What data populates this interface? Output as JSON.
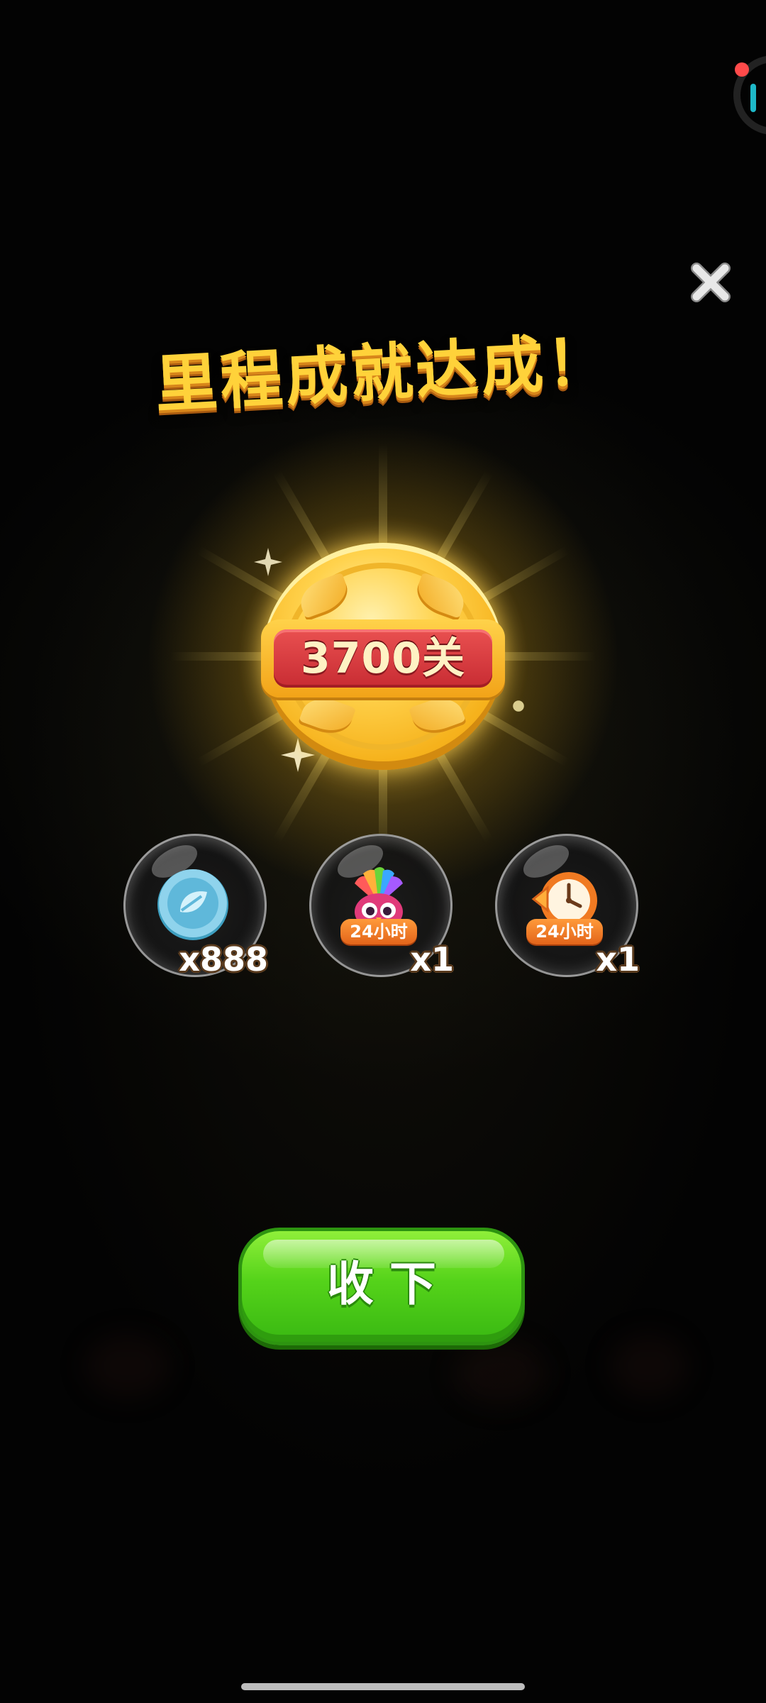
{
  "dialog": {
    "title": "里程成就达成！",
    "badge_label": "3700关"
  },
  "rewards": [
    {
      "icon": "coin-icon",
      "time_label": "",
      "quantity": "x888"
    },
    {
      "icon": "rainbow-owl-booster-icon",
      "time_label": "24小时",
      "quantity": "x1"
    },
    {
      "icon": "time-clock-booster-icon",
      "time_label": "24小时",
      "quantity": "x1"
    }
  ],
  "collect_button": {
    "label": "收下"
  },
  "colors": {
    "title": "#ffd23a",
    "plaque_red": "#d73a42",
    "button_green": "#55d31a",
    "time_tag_orange": "#f07a22"
  }
}
